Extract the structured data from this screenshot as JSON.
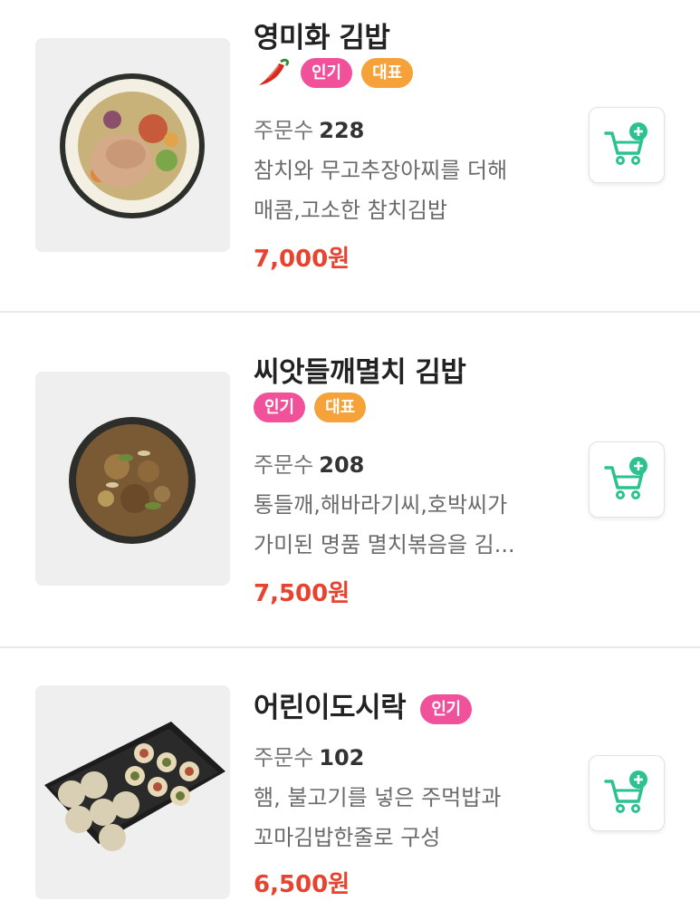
{
  "menu_items": [
    {
      "name": "영미화 김밥",
      "badges": [
        {
          "label": "인기",
          "color": "#f0519a"
        },
        {
          "label": "대표",
          "color": "#f6a23a"
        }
      ],
      "spicy_icon": "chili-pepper-icon",
      "orders_label": "주문수",
      "orders_count": "228",
      "description_line1": "참치와 무고추장아찌를 더해",
      "description_line2": "매콤,고소한 참치김밥",
      "price": "7,000원"
    },
    {
      "name": "씨앗들깨멸치 김밥",
      "badges": [
        {
          "label": "인기",
          "color": "#f0519a"
        },
        {
          "label": "대표",
          "color": "#f6a23a"
        }
      ],
      "orders_label": "주문수",
      "orders_count": "208",
      "description_line1": "통들깨,해바라기씨,호박씨가",
      "description_line2": "가미된 명품 멸치볶음을 김...",
      "price": "7,500원"
    },
    {
      "name": "어린이도시락",
      "badges": [
        {
          "label": "인기",
          "color": "#f0519a"
        }
      ],
      "orders_label": "주문수",
      "orders_count": "102",
      "description_line1": "햄, 불고기를 넣은 주먹밥과",
      "description_line2": "꼬마김밥한줄로 구성",
      "price": "6,500원"
    }
  ],
  "colors": {
    "price": "#e8432f",
    "cart_icon": "#2bc28f",
    "badge_popular": "#f0519a",
    "badge_signature": "#f6a23a"
  },
  "icons": {
    "cart": "add-to-cart-icon"
  }
}
